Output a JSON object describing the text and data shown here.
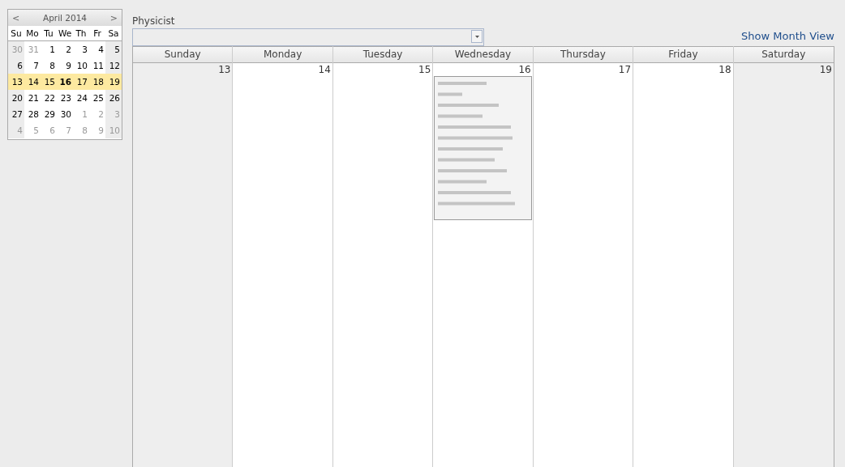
{
  "mini_calendar": {
    "title": "April 2014",
    "prev": "<",
    "next": ">",
    "weekdays": [
      "Su",
      "Mo",
      "Tu",
      "We",
      "Th",
      "Fr",
      "Sa"
    ],
    "weeks": [
      {
        "selected": false,
        "days": [
          {
            "label": "30",
            "other_month": true,
            "today": false
          },
          {
            "label": "31",
            "other_month": true,
            "today": false
          },
          {
            "label": "1",
            "other_month": false,
            "today": false
          },
          {
            "label": "2",
            "other_month": false,
            "today": false
          },
          {
            "label": "3",
            "other_month": false,
            "today": false
          },
          {
            "label": "4",
            "other_month": false,
            "today": false
          },
          {
            "label": "5",
            "other_month": false,
            "today": false
          }
        ]
      },
      {
        "selected": false,
        "days": [
          {
            "label": "6",
            "other_month": false,
            "today": false
          },
          {
            "label": "7",
            "other_month": false,
            "today": false
          },
          {
            "label": "8",
            "other_month": false,
            "today": false
          },
          {
            "label": "9",
            "other_month": false,
            "today": false
          },
          {
            "label": "10",
            "other_month": false,
            "today": false
          },
          {
            "label": "11",
            "other_month": false,
            "today": false
          },
          {
            "label": "12",
            "other_month": false,
            "today": false
          }
        ]
      },
      {
        "selected": true,
        "days": [
          {
            "label": "13",
            "other_month": false,
            "today": false
          },
          {
            "label": "14",
            "other_month": false,
            "today": false
          },
          {
            "label": "15",
            "other_month": false,
            "today": false
          },
          {
            "label": "16",
            "other_month": false,
            "today": true
          },
          {
            "label": "17",
            "other_month": false,
            "today": false
          },
          {
            "label": "18",
            "other_month": false,
            "today": false
          },
          {
            "label": "19",
            "other_month": false,
            "today": false
          }
        ]
      },
      {
        "selected": false,
        "days": [
          {
            "label": "20",
            "other_month": false,
            "today": false
          },
          {
            "label": "21",
            "other_month": false,
            "today": false
          },
          {
            "label": "22",
            "other_month": false,
            "today": false
          },
          {
            "label": "23",
            "other_month": false,
            "today": false
          },
          {
            "label": "24",
            "other_month": false,
            "today": false
          },
          {
            "label": "25",
            "other_month": false,
            "today": false
          },
          {
            "label": "26",
            "other_month": false,
            "today": false
          }
        ]
      },
      {
        "selected": false,
        "days": [
          {
            "label": "27",
            "other_month": false,
            "today": false
          },
          {
            "label": "28",
            "other_month": false,
            "today": false
          },
          {
            "label": "29",
            "other_month": false,
            "today": false
          },
          {
            "label": "30",
            "other_month": false,
            "today": false
          },
          {
            "label": "1",
            "other_month": true,
            "today": false
          },
          {
            "label": "2",
            "other_month": true,
            "today": false
          },
          {
            "label": "3",
            "other_month": true,
            "today": false
          }
        ]
      },
      {
        "selected": false,
        "days": [
          {
            "label": "4",
            "other_month": true,
            "today": false
          },
          {
            "label": "5",
            "other_month": true,
            "today": false
          },
          {
            "label": "6",
            "other_month": true,
            "today": false
          },
          {
            "label": "7",
            "other_month": true,
            "today": false
          },
          {
            "label": "8",
            "other_month": true,
            "today": false
          },
          {
            "label": "9",
            "other_month": true,
            "today": false
          },
          {
            "label": "10",
            "other_month": true,
            "today": false
          }
        ]
      }
    ]
  },
  "physicist": {
    "label": "Physicist"
  },
  "show_month_view": "Show Month View",
  "week_view": {
    "days": [
      {
        "name": "Sunday",
        "date": "13",
        "weekend": true
      },
      {
        "name": "Monday",
        "date": "14",
        "weekend": false
      },
      {
        "name": "Tuesday",
        "date": "15",
        "weekend": false
      },
      {
        "name": "Wednesday",
        "date": "16",
        "weekend": false,
        "events": [
          {
            "kind": "appointment"
          }
        ]
      },
      {
        "name": "Thursday",
        "date": "17",
        "weekend": false
      },
      {
        "name": "Friday",
        "date": "18",
        "weekend": false
      },
      {
        "name": "Saturday",
        "date": "19",
        "weekend": true
      }
    ]
  }
}
